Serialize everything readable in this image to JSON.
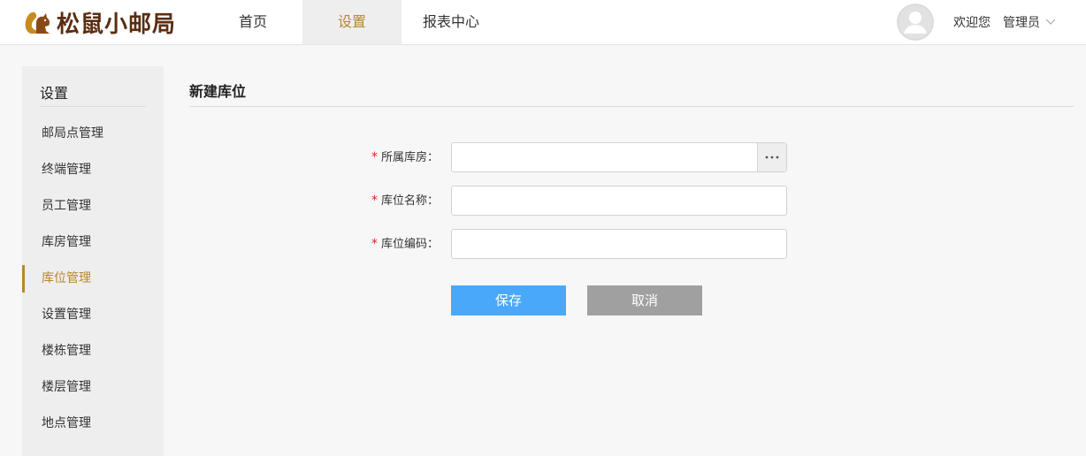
{
  "app": {
    "logo_text": "松鼠小邮局",
    "brand_color": "#5a2e12",
    "accent_color": "#b8862b"
  },
  "nav": {
    "items": [
      {
        "label": "首页",
        "active": false
      },
      {
        "label": "设置",
        "active": true
      },
      {
        "label": "报表中心",
        "active": false
      }
    ]
  },
  "user": {
    "welcome": "欢迎您",
    "name": "管理员",
    "avatar_icon": "user-avatar-icon"
  },
  "sidebar": {
    "title": "设置",
    "items": [
      {
        "label": "邮局点管理"
      },
      {
        "label": "终端管理"
      },
      {
        "label": "员工管理"
      },
      {
        "label": "库房管理"
      },
      {
        "label": "库位管理",
        "active": true
      },
      {
        "label": "设置管理"
      },
      {
        "label": "楼栋管理"
      },
      {
        "label": "楼层管理"
      },
      {
        "label": "地点管理"
      }
    ]
  },
  "page": {
    "title": "新建库位"
  },
  "form": {
    "required_mark": "*",
    "fields": [
      {
        "label": "所属库房：",
        "value": "",
        "picker_icon": "ellipsis-icon"
      },
      {
        "label": "库位名称：",
        "value": ""
      },
      {
        "label": "库位编码：",
        "value": ""
      }
    ],
    "save_label": "保存",
    "cancel_label": "取消",
    "save_color": "#4aa8fb",
    "cancel_color": "#a0a0a0"
  }
}
